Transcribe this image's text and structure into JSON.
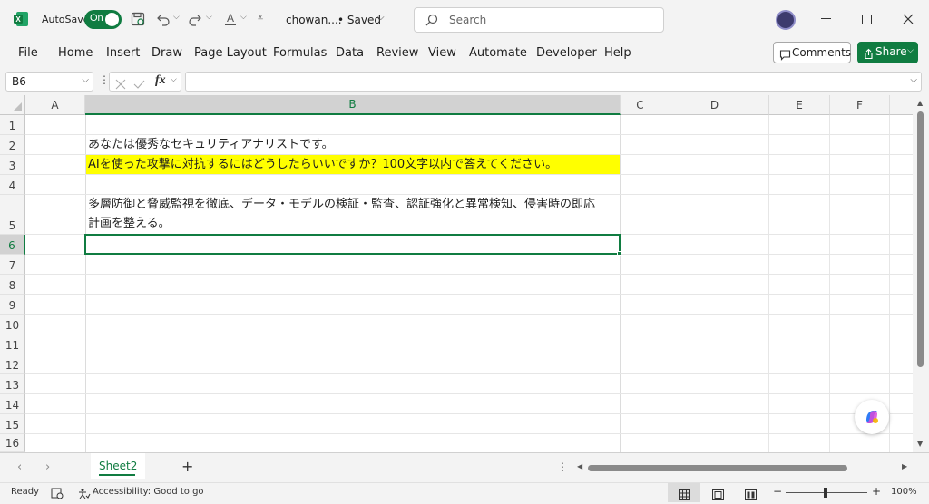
{
  "app": {
    "autosave_label": "AutoSave",
    "autosave_state": "On",
    "filename": "chowan....",
    "saved_status": "• Saved",
    "search_placeholder": "Search",
    "brand_color": "#107c41"
  },
  "menu": {
    "items": [
      "File",
      "Home",
      "Insert",
      "Draw",
      "Page Layout",
      "Formulas",
      "Data",
      "Review",
      "View",
      "Automate",
      "Developer",
      "Help"
    ],
    "comments_label": "Comments",
    "share_label": "Share"
  },
  "formula_bar": {
    "name_box": "B6",
    "fx_label": "fx",
    "formula": ""
  },
  "grid": {
    "columns": [
      "A",
      "B",
      "C",
      "D",
      "E",
      "F"
    ],
    "selected_column": "B",
    "rows": [
      "1",
      "2",
      "3",
      "4",
      "5",
      "6",
      "7",
      "8",
      "9",
      "10",
      "11",
      "12",
      "13",
      "14",
      "15",
      "16"
    ],
    "selected_row": "6",
    "cells": {
      "B2": "あなたは優秀なセキュリティアナリストです。",
      "B3": "AIを使った攻撃に対抗するにはどうしたらいいですか？100文字以内で答えてください。",
      "B5_line1": "多層防御と脅威監視を徹底、データ・モデルの検証・監査、認証強化と異常検知、侵害時の即応",
      "B5_line2": "計画を整える。"
    },
    "highlight_color": "#ffff00"
  },
  "sheets": {
    "active": "Sheet2",
    "add_label": "+"
  },
  "status": {
    "ready": "Ready",
    "accessibility": "Accessibility: Good to go",
    "zoom": "100%"
  }
}
